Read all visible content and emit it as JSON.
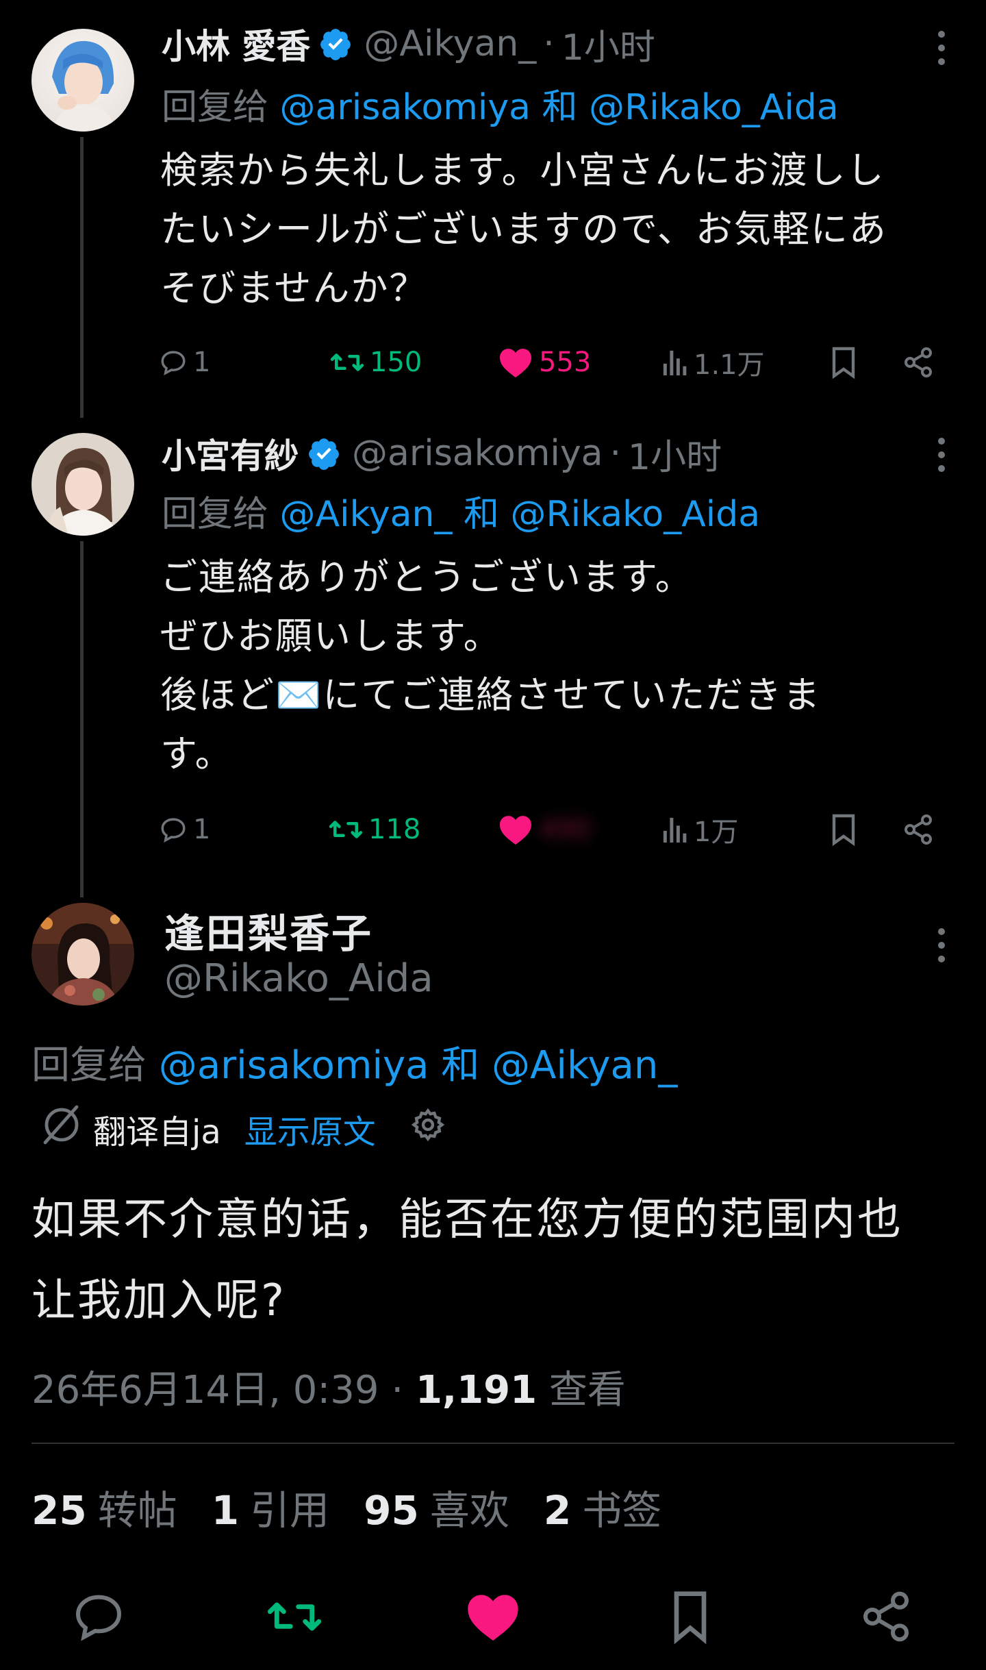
{
  "tweets": [
    {
      "name": "小林 愛香",
      "handle": "@Aikyan_",
      "sep": "·",
      "time": "1小时",
      "reply_prefix": "回复给",
      "reply_to_1": "@arisakomiya",
      "reply_and": "和",
      "reply_to_2": "@Rikako_Aida",
      "text": "検索から失礼します。小宮さんにお渡しし\nたいシールがございますので、お気軽にあ\nそびませんか？",
      "replies": "1",
      "retweets": "150",
      "likes": "553",
      "views": "1.1万"
    },
    {
      "name": "小宮有紗",
      "handle": "@arisakomiya",
      "sep": "·",
      "time": "1小时",
      "reply_prefix": "回复给",
      "reply_to_1": "@Aikyan_",
      "reply_and": "和",
      "reply_to_2": "@Rikako_Aida",
      "text": "ご連絡ありがとうございます。\nぜひお願いします。\n後ほど✉️にてご連絡させていただきま\nす。",
      "replies": "1",
      "retweets": "118",
      "likes": "490",
      "views": "1万"
    }
  ],
  "main_tweet": {
    "name": "逢田梨香子",
    "handle": "@Rikako_Aida",
    "reply_prefix": "回复给",
    "reply_to_1": "@arisakomiya",
    "reply_and": "和",
    "reply_to_2": "@Aikyan_",
    "translated_from": "翻译自ja",
    "show_original": "显示原文",
    "text": "如果不介意的话，能否在您方便的范围内也\n让我加入呢?",
    "timestamp": "26年6月14日, 0:39",
    "sep": "·",
    "views_count": "1,191",
    "views_label": "查看",
    "stats": [
      {
        "num": "25",
        "label": "转帖"
      },
      {
        "num": "1",
        "label": "引用"
      },
      {
        "num": "95",
        "label": "喜欢"
      },
      {
        "num": "2",
        "label": "书签"
      }
    ]
  },
  "colors": {
    "background": "#000000",
    "text": "#e7e9ea",
    "secondary": "#71767b",
    "link": "#1d9bf0",
    "retweet": "#00ba7c",
    "like": "#f91880",
    "verified": "#1d9bf0"
  },
  "icons": {
    "reply": "speech-bubble-icon",
    "retweet": "retweet-arrows-icon",
    "like": "heart-icon",
    "views": "bar-chart-icon",
    "bookmark": "bookmark-icon",
    "share": "share-icon",
    "more": "vertical-dots-icon",
    "verified": "verified-badge-icon",
    "translate": "translate-icon",
    "settings": "gear-icon"
  }
}
